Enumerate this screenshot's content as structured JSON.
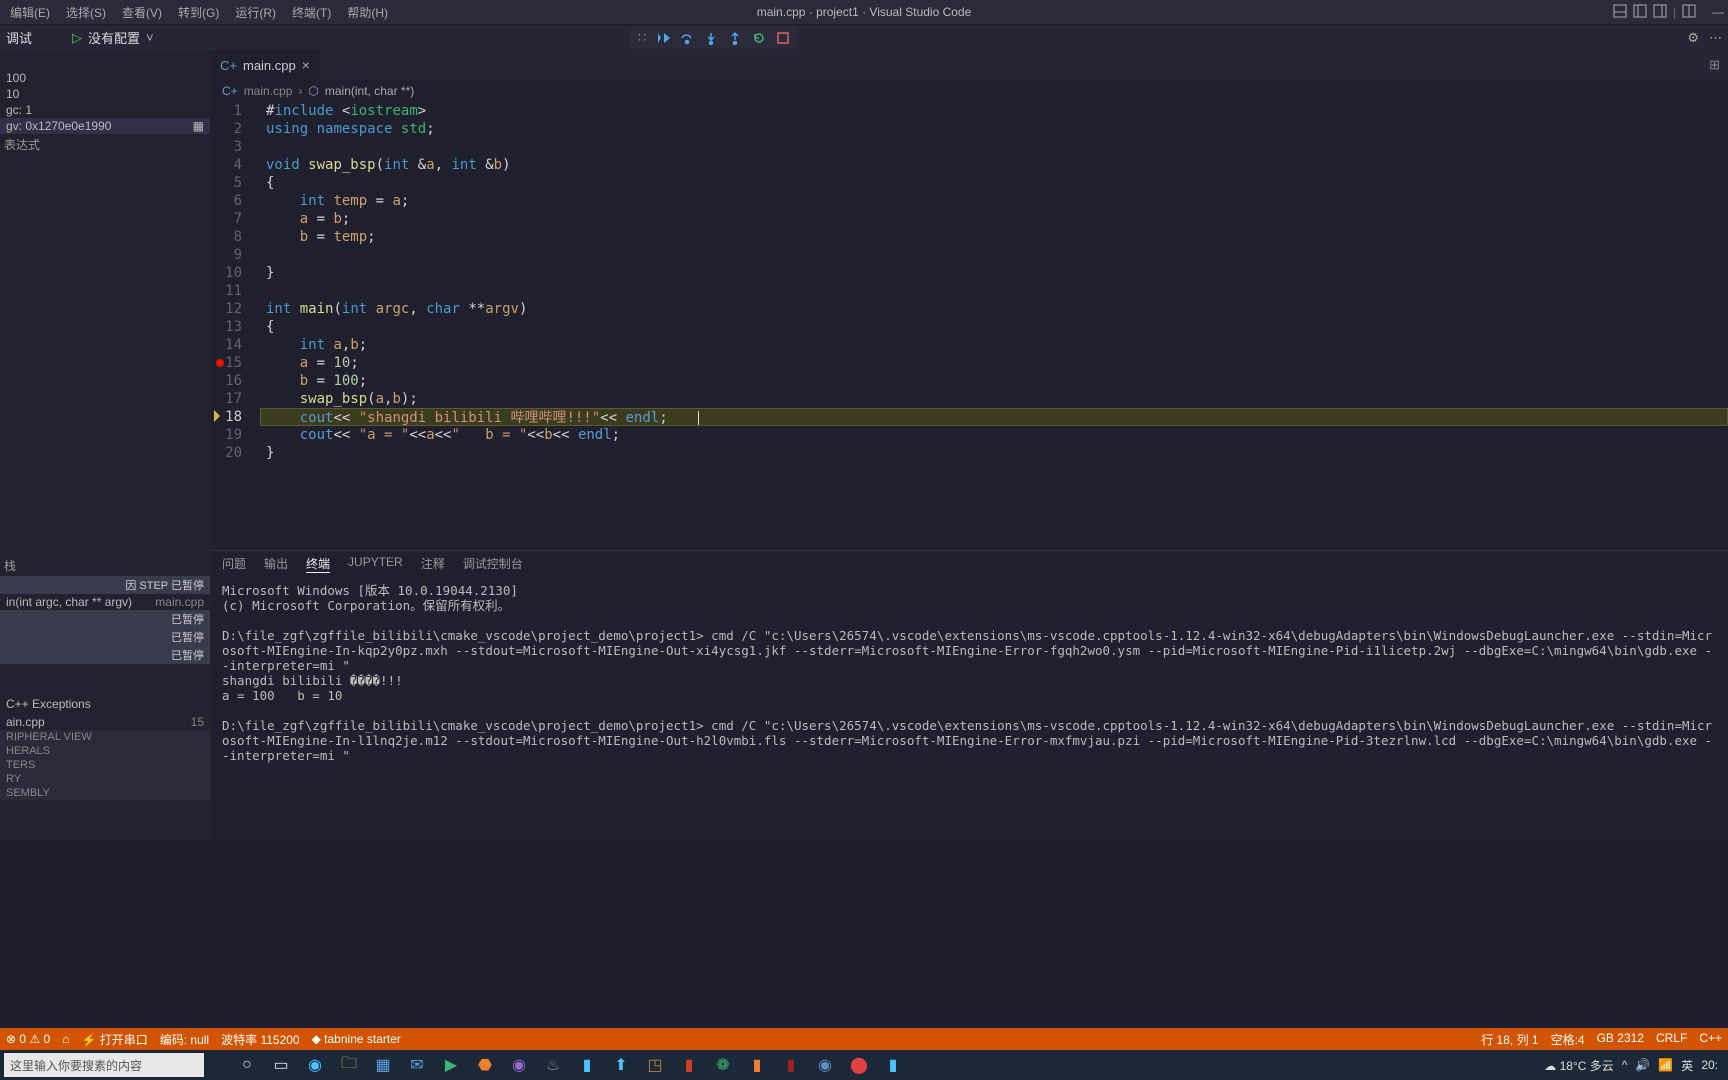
{
  "menus": [
    "编辑(E)",
    "选择(S)",
    "查看(V)",
    "转到(G)",
    "运行(R)",
    "终端(T)",
    "帮助(H)"
  ],
  "title": "main.cpp · project1 · Visual Studio Code",
  "debug_label": "没有配置",
  "sidebar": {
    "section0": "调试",
    "vars": [
      "100",
      "10",
      "gc: 1",
      "gv: 0x1270e0e1990"
    ],
    "watch": "表达式",
    "stack_pause": "因 STEP 已暂停",
    "stack_frame": "in(int argc, char ** argv)",
    "stack_file": "main.cpp",
    "paused_labels": [
      "已暂停",
      "已暂停",
      "已暂停"
    ],
    "cpp_ex": "C++ Exceptions",
    "bp_file": "ain.cpp",
    "bp_line": "15",
    "sections": [
      "RIPHERAL VIEW",
      "HERALS",
      "TERS",
      "RY",
      "SEMBLY"
    ]
  },
  "tab_name": "main.cpp",
  "breadcrumb_file": "main.cpp",
  "breadcrumb_fn": "main(int, char **)",
  "code_lines": [
    "#include <iostream>",
    "using namespace std;",
    "",
    "void swap_bsp(int &a, int &b)",
    "{",
    "    int temp = a;",
    "    a = b;",
    "    b = temp;",
    "",
    "}",
    "",
    "int main(int argc, char **argv)",
    "{",
    "    int a,b;",
    "    a = 10;",
    "    b = 100;",
    "    swap_bsp(a,b);",
    "    cout<< \"shangdi bilibili 哔哩哔哩!!!\"<< endl;",
    "    cout<< \"a = \"<<a<<\"   b = \"<<b<< endl;",
    "}"
  ],
  "panel_tabs": [
    "问题",
    "输出",
    "终端",
    "JUPYTER",
    "注释",
    "调试控制台"
  ],
  "term": "Microsoft Windows [版本 10.0.19044.2130]\n(c) Microsoft Corporation。保留所有权利。\n\nD:\\file_zgf\\zgffile_bilibili\\cmake_vscode\\project_demo\\project1> cmd /C \"c:\\Users\\26574\\.vscode\\extensions\\ms-vscode.cpptools-1.12.4-win32-x64\\debugAdapters\\bin\\WindowsDebugLauncher.exe --stdin=Microsoft-MIEngine-In-kqp2y0pz.mxh --stdout=Microsoft-MIEngine-Out-xi4ycsg1.jkf --stderr=Microsoft-MIEngine-Error-fgqh2wo0.ysm --pid=Microsoft-MIEngine-Pid-i1licetp.2wj --dbgExe=C:\\mingw64\\bin\\gdb.exe --interpreter=mi \"\nshangdi bilibili ����!!!\na = 100   b = 10\n\nD:\\file_zgf\\zgffile_bilibili\\cmake_vscode\\project_demo\\project1> cmd /C \"c:\\Users\\26574\\.vscode\\extensions\\ms-vscode.cpptools-1.12.4-win32-x64\\debugAdapters\\bin\\WindowsDebugLauncher.exe --stdin=Microsoft-MIEngine-In-l1lnq2je.m12 --stdout=Microsoft-MIEngine-Out-h2l0vmbi.fls --stderr=Microsoft-MIEngine-Error-mxfmvjau.pzi --pid=Microsoft-MIEngine-Pid-3tezrlnw.lcd --dbgExe=C:\\mingw64\\bin\\gdb.exe --interpreter=mi \"",
  "status": {
    "l0": "0",
    "serial": "打开串口",
    "encoding": "编码: null",
    "baud": "波特率 115200",
    "tabnine": "tabnine starter",
    "lncol": "行 18, 列 1",
    "spaces": "空格:4",
    "gb": "GB 2312",
    "crlf": "CRLF",
    "lang": "C++"
  },
  "taskbar": {
    "search_ph": "这里输入你要搜素的内容",
    "weather": "18°C 多云",
    "ime": "英"
  }
}
